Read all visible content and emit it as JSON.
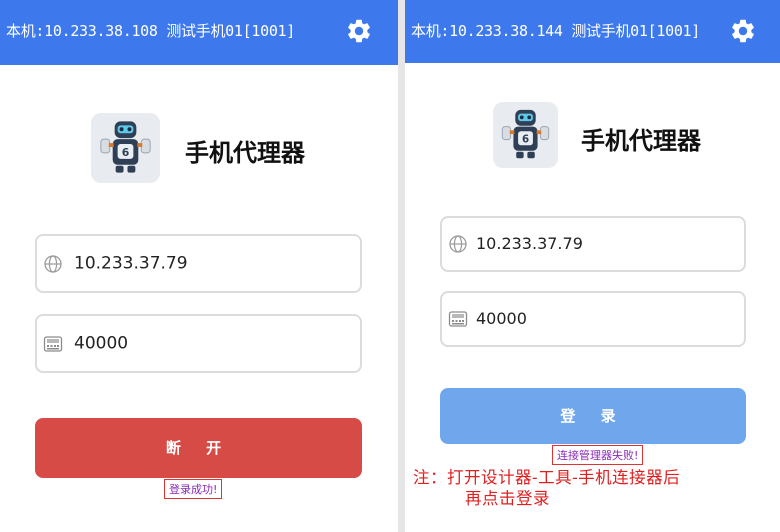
{
  "left_panel": {
    "header_title": "本机:10.233.38.108 测试手机01[1001]",
    "app_title": "手机代理器",
    "ip_value": "10.233.37.79",
    "port_value": "40000",
    "button_label": "断 开",
    "toast": "登录成功!",
    "button_color": "#d64b46"
  },
  "right_panel": {
    "header_title": "本机:10.233.38.144 测试手机01[1001]",
    "app_title": "手机代理器",
    "ip_value": "10.233.37.79",
    "port_value": "40000",
    "button_label": "登 录",
    "toast": "连接管理器失败!",
    "button_color": "#6fa6ec",
    "note_line1": "注：打开设计器-工具-手机连接器后",
    "note_line2": "再点击登录"
  },
  "colors": {
    "header": "#3d79ec",
    "note": "#e01f1f",
    "toast_text": "#8a2bb5"
  },
  "icons": [
    "gear-icon",
    "robot-logo-icon",
    "globe-icon",
    "phone-icon"
  ]
}
